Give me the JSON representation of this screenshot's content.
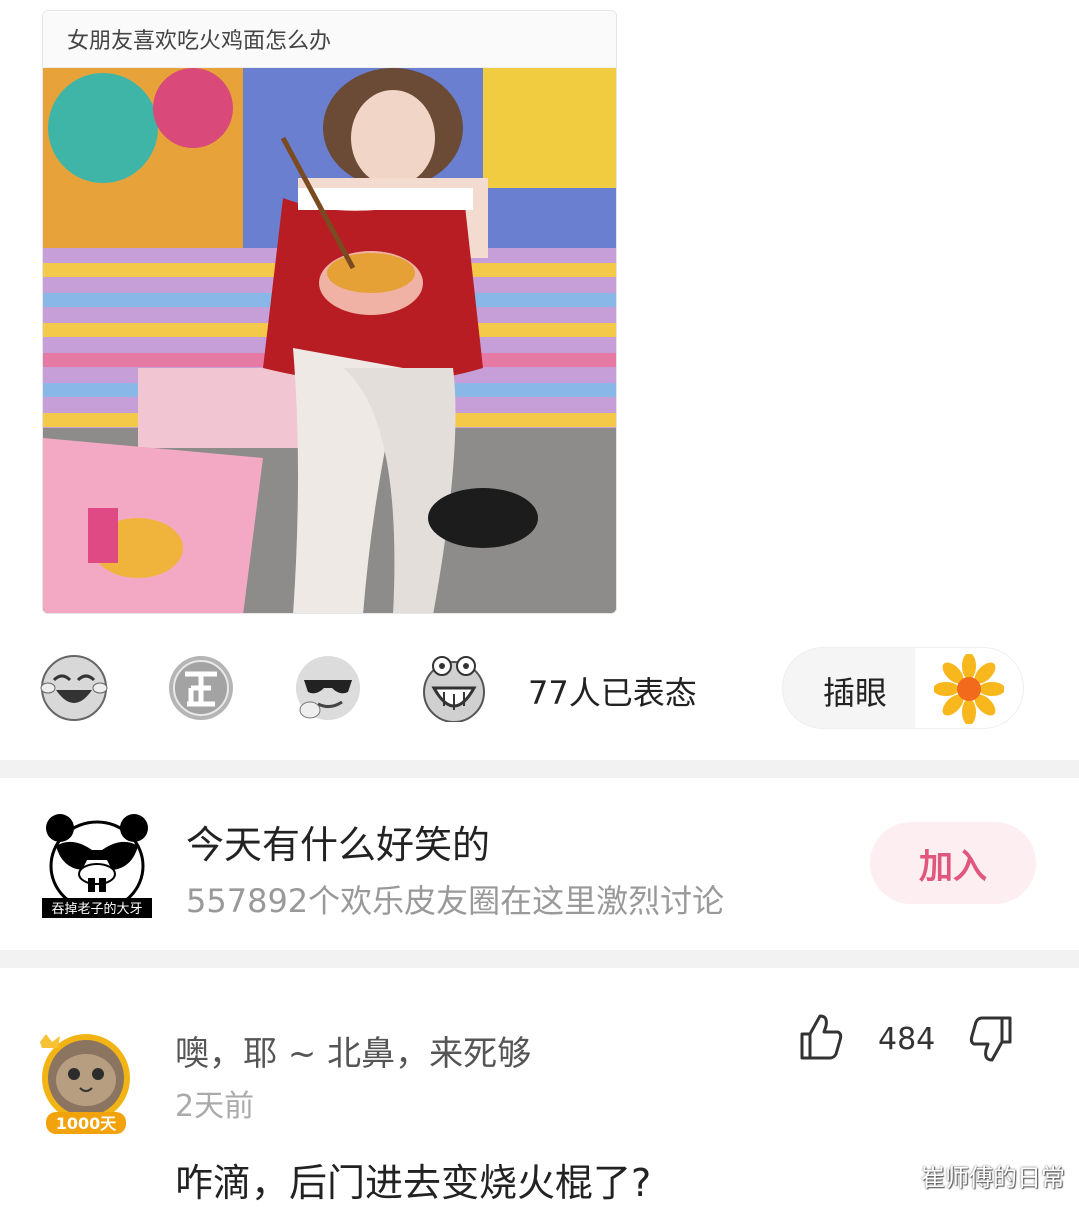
{
  "post": {
    "title": "女朋友喜欢吃火鸡面怎么办"
  },
  "reactions": {
    "emojis": [
      "laugh-cry-icon",
      "zheng-icon",
      "sunglasses-icon",
      "grin-icon"
    ],
    "count_text": "77人已表态",
    "poke_label": "插眼"
  },
  "community": {
    "avatar_caption": "吞掉老子的大牙",
    "name": "今天有什么好笑的",
    "description": "557892个欢乐皮友圈在这里激烈讨论",
    "join_label": "加入"
  },
  "comment": {
    "author": "噢，耶 ~ 北鼻，来死够",
    "time": "2天前",
    "text": "咋滴，后门进去变烧火棍了?",
    "like_count": "484",
    "avatar_badge": "1000天"
  },
  "watermark": "崔师傅的日常",
  "colors": {
    "accent_pink": "#e0567c",
    "join_bg": "#fdeef2"
  }
}
